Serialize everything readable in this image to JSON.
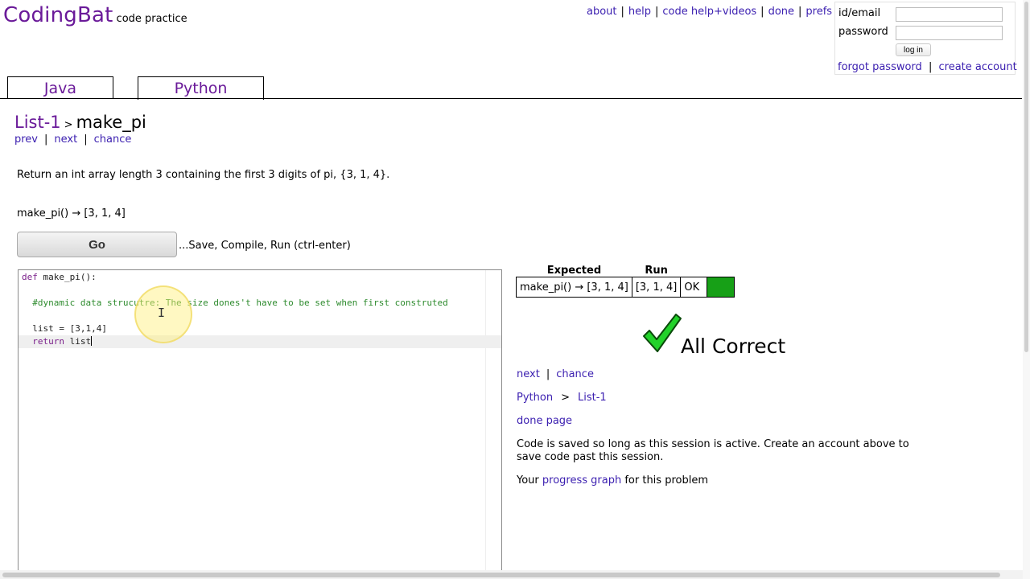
{
  "header": {
    "brand": "CodingBat",
    "tagline": "code practice",
    "nav": [
      "about",
      "help",
      "code help+videos",
      "done",
      "prefs"
    ]
  },
  "login": {
    "email_label": "id/email",
    "password_label": "password",
    "login_button": "log in",
    "forgot": "forgot password",
    "create": "create account"
  },
  "tabs": {
    "java": "Java",
    "python": "Python"
  },
  "problem": {
    "section": "List-1",
    "name": "make_pi",
    "prev": "prev",
    "next": "next",
    "chance": "chance",
    "description": "Return an int array length 3 containing the first 3 digits of pi, {3, 1, 4}.",
    "example": "make_pi() → [3, 1, 4]"
  },
  "run": {
    "go_label": "Go",
    "hint": "...Save, Compile, Run (ctrl-enter)"
  },
  "code": {
    "l1_kw": "def",
    "l1_rest": " make_pi():",
    "l2": "  #dynamic data strucutre: The size dones't have to be set when first construted",
    "l3": "  list = [3,1,4]",
    "l4_kw": "  return",
    "l4_rest": " list"
  },
  "results": {
    "head_expected": "Expected",
    "head_run": "Run",
    "expected": "make_pi() → [3, 1, 4]",
    "run": "[3, 1, 4]",
    "status": "OK",
    "status_color": "#17a017",
    "summary": "All Correct"
  },
  "after": {
    "next": "next",
    "chance": "chance",
    "crumb_lang": "Python",
    "crumb_gt": ">",
    "crumb_section": "List-1",
    "done_page": "done page",
    "saved_note": "Code is saved so long as this session is active. Create an account above to save code past this session.",
    "progress_prefix": "Your ",
    "progress_link": "progress graph",
    "progress_suffix": " for this problem"
  }
}
